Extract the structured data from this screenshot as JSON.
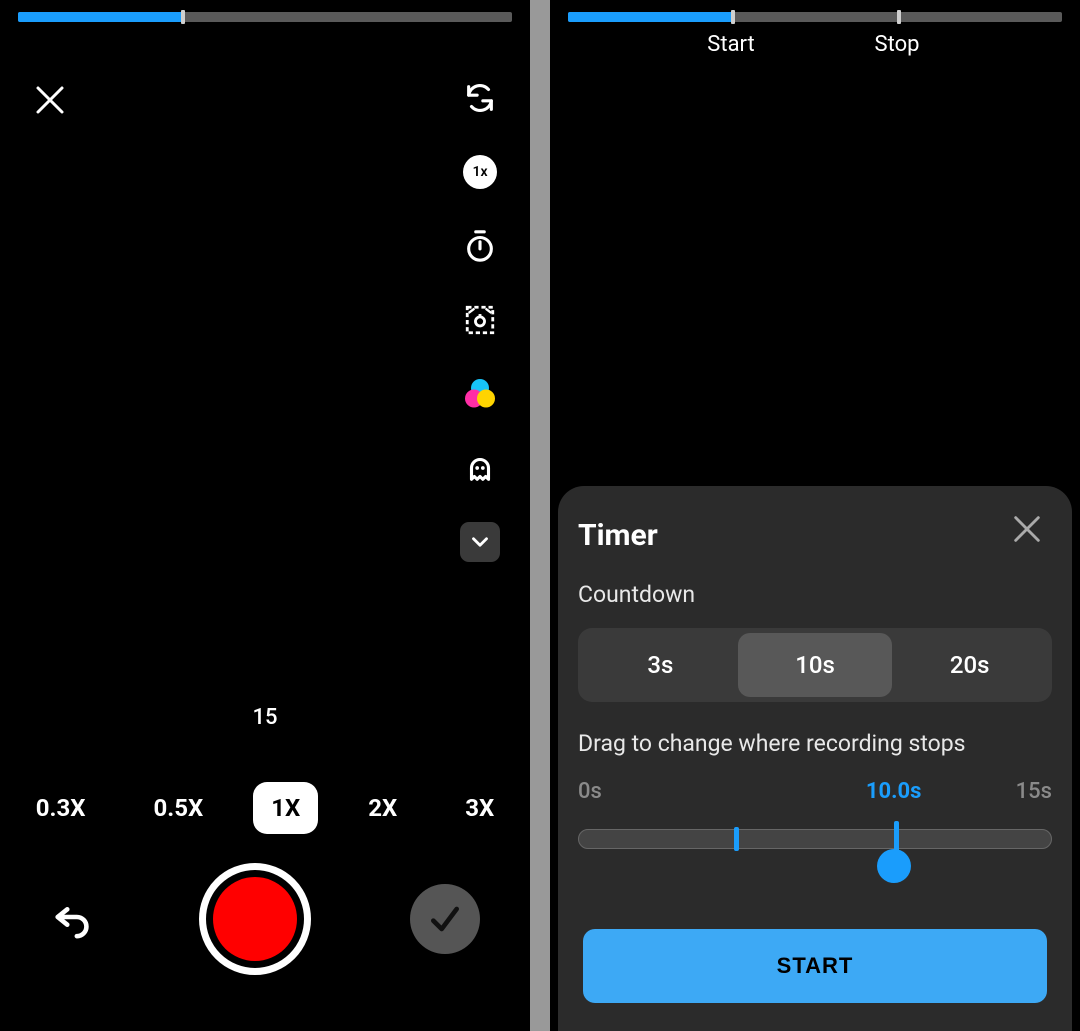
{
  "left": {
    "progress_percent": 33,
    "speed_badge": "1x",
    "remaining_label": "15",
    "zoom_options": [
      "0.3X",
      "0.5X",
      "1X",
      "2X",
      "3X"
    ],
    "zoom_selected_index": 2
  },
  "right": {
    "progress_percent": 33,
    "stop_percent": 66.6,
    "markers": {
      "start": "Start",
      "stop": "Stop"
    },
    "sheet": {
      "title": "Timer",
      "countdown_label": "Countdown",
      "options": [
        "3s",
        "10s",
        "20s"
      ],
      "selected_index": 1,
      "drag_hint": "Drag to change where recording stops",
      "scale": {
        "min": "0s",
        "value": "10.0s",
        "max": "15s"
      },
      "slider": {
        "start_percent": 33,
        "stop_percent": 66.6
      },
      "button": "START"
    }
  },
  "colors": {
    "accent": "#1a9dfc",
    "record": "#f00"
  }
}
